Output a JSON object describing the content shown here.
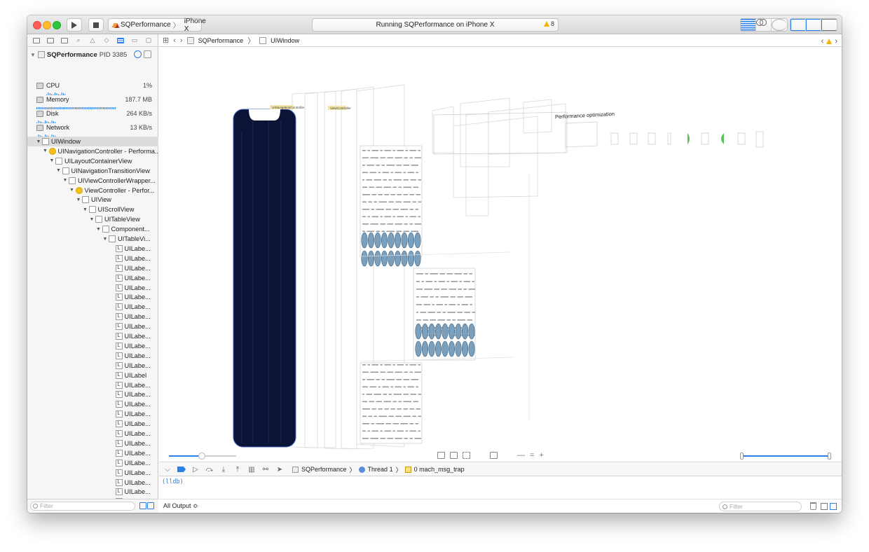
{
  "toolbar": {
    "scheme": "SQPerformance",
    "device": "iPhone X",
    "activity": "Running SQPerformance on iPhone X",
    "warning_count": "8"
  },
  "navigator": {
    "process_name": "SQPerformance",
    "process_pid": "PID 3385",
    "gauges": [
      {
        "label": "CPU",
        "value": "1%"
      },
      {
        "label": "Memory",
        "value": "187.7 MB"
      },
      {
        "label": "Disk",
        "value": "264 KB/s"
      },
      {
        "label": "Network",
        "value": "13 KB/s"
      }
    ],
    "tree": [
      {
        "text": "UIWindow",
        "depth": 0,
        "icon": "box",
        "selected": true
      },
      {
        "text": "UINavigationController - Performa...",
        "depth": 1,
        "icon": "vc"
      },
      {
        "text": "UILayoutContainerView",
        "depth": 2,
        "icon": "box"
      },
      {
        "text": "UINavigationTransitionView",
        "depth": 3,
        "icon": "box"
      },
      {
        "text": "UIViewControllerWrapper...",
        "depth": 4,
        "icon": "box"
      },
      {
        "text": "ViewController - Perfor...",
        "depth": 5,
        "icon": "vc"
      },
      {
        "text": "UIView",
        "depth": 6,
        "icon": "box"
      },
      {
        "text": "UIScrollView",
        "depth": 7,
        "icon": "box"
      },
      {
        "text": "UITableView",
        "depth": 8,
        "icon": "box"
      },
      {
        "text": "Component...",
        "depth": 9,
        "icon": "box"
      },
      {
        "text": "UITableVi...",
        "depth": 10,
        "icon": "box"
      },
      {
        "text": "UILabe...",
        "depth": 11,
        "icon": "label"
      },
      {
        "text": "UILabe...",
        "depth": 11,
        "icon": "label"
      },
      {
        "text": "UILabe...",
        "depth": 11,
        "icon": "label"
      },
      {
        "text": "UILabe...",
        "depth": 11,
        "icon": "label"
      },
      {
        "text": "UILabe...",
        "depth": 11,
        "icon": "label"
      },
      {
        "text": "UILabe...",
        "depth": 11,
        "icon": "label"
      },
      {
        "text": "UILabe...",
        "depth": 11,
        "icon": "label"
      },
      {
        "text": "UILabe...",
        "depth": 11,
        "icon": "label"
      },
      {
        "text": "UILabe...",
        "depth": 11,
        "icon": "label"
      },
      {
        "text": "UILabe...",
        "depth": 11,
        "icon": "label"
      },
      {
        "text": "UILabe...",
        "depth": 11,
        "icon": "label"
      },
      {
        "text": "UILabe...",
        "depth": 11,
        "icon": "label"
      },
      {
        "text": "UILabe...",
        "depth": 11,
        "icon": "label"
      },
      {
        "text": "UILabel",
        "depth": 11,
        "icon": "label"
      },
      {
        "text": "UILabe...",
        "depth": 11,
        "icon": "label"
      },
      {
        "text": "UILabe...",
        "depth": 11,
        "icon": "label"
      },
      {
        "text": "UILabe...",
        "depth": 11,
        "icon": "label"
      },
      {
        "text": "UILabe...",
        "depth": 11,
        "icon": "label"
      },
      {
        "text": "UILabe...",
        "depth": 11,
        "icon": "label"
      },
      {
        "text": "UILabe...",
        "depth": 11,
        "icon": "label"
      },
      {
        "text": "UILabe...",
        "depth": 11,
        "icon": "label"
      },
      {
        "text": "UILabe...",
        "depth": 11,
        "icon": "label"
      },
      {
        "text": "UILabe...",
        "depth": 11,
        "icon": "label"
      },
      {
        "text": "UILabe...",
        "depth": 11,
        "icon": "label"
      },
      {
        "text": "UILabe...",
        "depth": 11,
        "icon": "label"
      },
      {
        "text": "UILabe...",
        "depth": 11,
        "icon": "label"
      },
      {
        "text": "UILabe...",
        "depth": 11,
        "icon": "label"
      },
      {
        "text": "UILabe...",
        "depth": 11,
        "icon": "label"
      }
    ],
    "filter_placeholder": "Filter"
  },
  "jump_bar": {
    "crumbs": [
      "SQPerformance",
      "UIWindow"
    ]
  },
  "canvas": {
    "nav_controller_label": "UINavigationController",
    "view_controller_label": "ViewController",
    "nav_title": "Performance optimization"
  },
  "debug_bar": {
    "crumbs": [
      "SQPerformance",
      "Thread 1",
      "0 mach_msg_trap"
    ]
  },
  "console": {
    "prompt": "(lldb)",
    "output_selector": "All Output ≎",
    "filter_placeholder": "Filter"
  },
  "colors": {
    "accent": "#2a7fe8",
    "phone_screen": "#0b1437"
  }
}
